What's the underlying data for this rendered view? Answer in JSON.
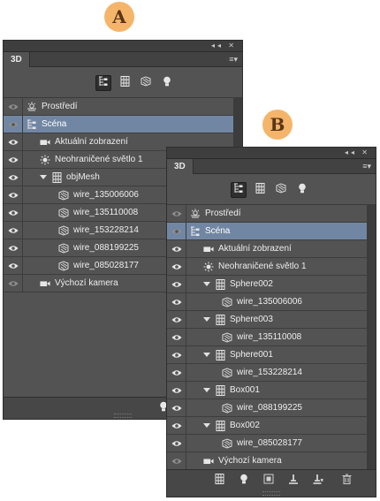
{
  "badges": {
    "a": "A",
    "b": "B"
  },
  "controls": {
    "collapse": "◂◂",
    "close": "✕",
    "menu": "≡▾"
  },
  "panelA": {
    "tab": "3D",
    "rows": [
      {
        "label": "Prostředí",
        "icon": "environment",
        "indent": 0,
        "expandable": false,
        "selected": false,
        "eye": "dim"
      },
      {
        "label": "Scéna",
        "icon": "scene",
        "indent": 0,
        "expandable": false,
        "selected": true,
        "eye": "dim"
      },
      {
        "label": "Aktuální zobrazení",
        "icon": "camera",
        "indent": 1,
        "expandable": false,
        "selected": false,
        "eye": "on"
      },
      {
        "label": "Neohraničené světlo 1",
        "icon": "light",
        "indent": 1,
        "expandable": false,
        "selected": false,
        "eye": "on"
      },
      {
        "label": "objMesh",
        "icon": "mesh",
        "indent": 1,
        "expandable": true,
        "selected": false,
        "eye": "on"
      },
      {
        "label": "wire_135006006",
        "icon": "material",
        "indent": 2,
        "expandable": false,
        "selected": false,
        "eye": "on"
      },
      {
        "label": "wire_135110008",
        "icon": "material",
        "indent": 2,
        "expandable": false,
        "selected": false,
        "eye": "on"
      },
      {
        "label": "wire_153228214",
        "icon": "material",
        "indent": 2,
        "expandable": false,
        "selected": false,
        "eye": "on"
      },
      {
        "label": "wire_088199225",
        "icon": "material",
        "indent": 2,
        "expandable": false,
        "selected": false,
        "eye": "on"
      },
      {
        "label": "wire_085028177",
        "icon": "material",
        "indent": 2,
        "expandable": false,
        "selected": false,
        "eye": "on"
      },
      {
        "label": "Výchozí kamera",
        "icon": "camera",
        "indent": 1,
        "expandable": false,
        "selected": false,
        "eye": "dim"
      }
    ]
  },
  "panelB": {
    "tab": "3D",
    "rows": [
      {
        "label": "Prostředí",
        "icon": "environment",
        "indent": 0,
        "expandable": false,
        "selected": false,
        "eye": "dim"
      },
      {
        "label": "Scéna",
        "icon": "scene",
        "indent": 0,
        "expandable": false,
        "selected": true,
        "eye": "dim"
      },
      {
        "label": "Aktuální zobrazení",
        "icon": "camera",
        "indent": 1,
        "expandable": false,
        "selected": false,
        "eye": "on"
      },
      {
        "label": "Neohraničené světlo 1",
        "icon": "light",
        "indent": 1,
        "expandable": false,
        "selected": false,
        "eye": "on"
      },
      {
        "label": "Sphere002",
        "icon": "mesh",
        "indent": 1,
        "expandable": true,
        "selected": false,
        "eye": "on"
      },
      {
        "label": "wire_135006006",
        "icon": "material",
        "indent": 2,
        "expandable": false,
        "selected": false,
        "eye": "on"
      },
      {
        "label": "Sphere003",
        "icon": "mesh",
        "indent": 1,
        "expandable": true,
        "selected": false,
        "eye": "on"
      },
      {
        "label": "wire_135110008",
        "icon": "material",
        "indent": 2,
        "expandable": false,
        "selected": false,
        "eye": "on"
      },
      {
        "label": "Sphere001",
        "icon": "mesh",
        "indent": 1,
        "expandable": true,
        "selected": false,
        "eye": "on"
      },
      {
        "label": "wire_153228214",
        "icon": "material",
        "indent": 2,
        "expandable": false,
        "selected": false,
        "eye": "on"
      },
      {
        "label": "Box001",
        "icon": "mesh",
        "indent": 1,
        "expandable": true,
        "selected": false,
        "eye": "on"
      },
      {
        "label": "wire_088199225",
        "icon": "material",
        "indent": 2,
        "expandable": false,
        "selected": false,
        "eye": "on"
      },
      {
        "label": "Box002",
        "icon": "mesh",
        "indent": 1,
        "expandable": true,
        "selected": false,
        "eye": "on"
      },
      {
        "label": "wire_085028177",
        "icon": "material",
        "indent": 2,
        "expandable": false,
        "selected": false,
        "eye": "on"
      },
      {
        "label": "Výchozí kamera",
        "icon": "camera",
        "indent": 1,
        "expandable": false,
        "selected": false,
        "eye": "dim"
      }
    ]
  },
  "filter_icons": [
    "scene-filter-icon",
    "mesh-filter-icon",
    "material-filter-icon",
    "light-filter-icon"
  ],
  "bottom_icons": [
    "add-mesh-icon",
    "add-light-icon",
    "render-icon",
    "ground-icon",
    "delete-light-icon",
    "trash-icon"
  ],
  "colors": {
    "panel": "#535353",
    "selection": "#7186a3",
    "badge": "#f4b56a"
  }
}
